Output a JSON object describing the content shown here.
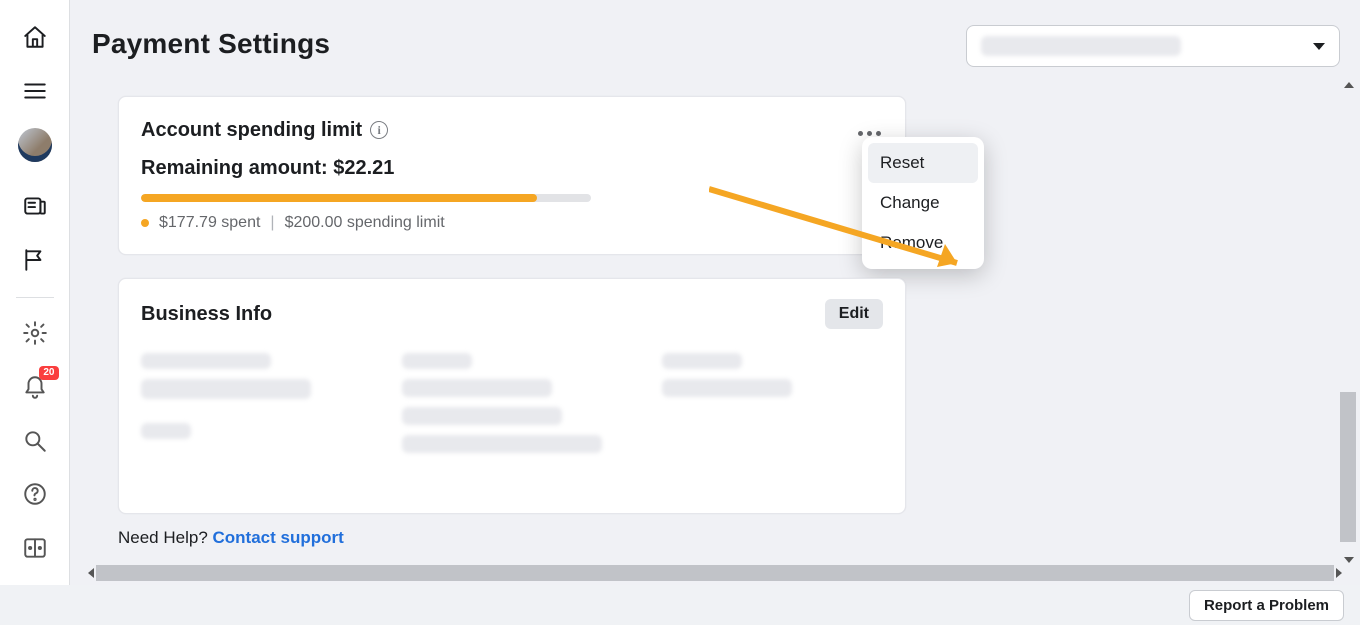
{
  "left_rail": {
    "badge_count": "20"
  },
  "header": {
    "page_title": "Payment Settings"
  },
  "spending_limit": {
    "card_title": "Account spending limit",
    "remaining_label": "Remaining amount:",
    "remaining_amount": "$22.21",
    "progress_percent": 88,
    "spent_text": "$177.79 spent",
    "limit_text": "$200.00 spending limit",
    "menu": {
      "reset": "Reset",
      "change": "Change",
      "remove": "Remove"
    }
  },
  "business_info": {
    "title": "Business Info",
    "edit_label": "Edit"
  },
  "help": {
    "label": "Need Help?",
    "link": "Contact support"
  },
  "footer": {
    "report": "Report a Problem"
  }
}
